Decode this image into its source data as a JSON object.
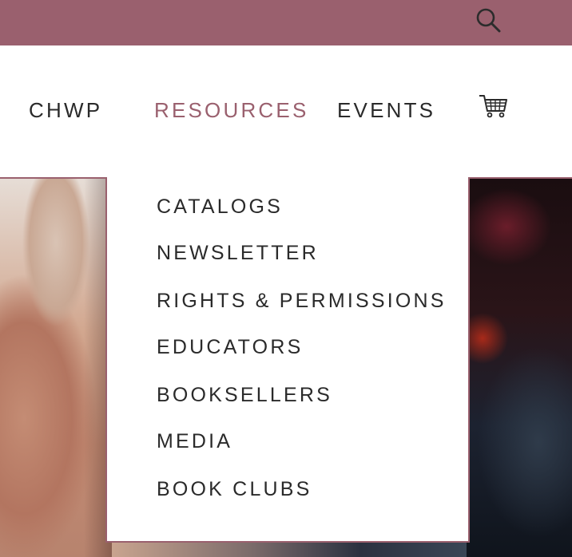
{
  "header": {
    "search_icon": "search-icon"
  },
  "nav": {
    "items": [
      {
        "label": "CHWP",
        "active": false
      },
      {
        "label": "RESOURCES",
        "active": true
      },
      {
        "label": "EVENTS",
        "active": false
      }
    ],
    "cart_icon": "cart-icon"
  },
  "dropdown": {
    "items": [
      {
        "label": "CATALOGS"
      },
      {
        "label": "NEWSLETTER"
      },
      {
        "label": "RIGHTS & PERMISSIONS"
      },
      {
        "label": "EDUCATORS"
      },
      {
        "label": "BOOKSELLERS"
      },
      {
        "label": "MEDIA"
      },
      {
        "label": "BOOK CLUBS"
      }
    ]
  },
  "colors": {
    "accent": "#9a606e",
    "text": "#2a2a2a"
  }
}
